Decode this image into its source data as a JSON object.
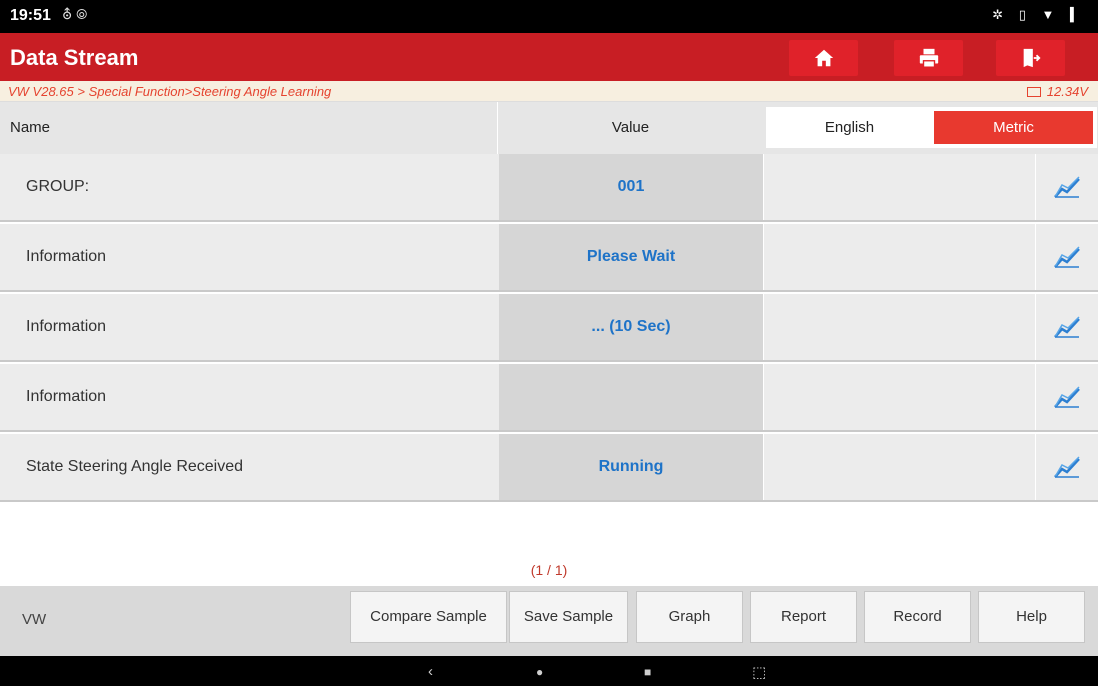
{
  "status": {
    "time": "19:51",
    "left_icons": "⛢ ⦾",
    "right_icons": "✲ ▯ ▼ ▍"
  },
  "header": {
    "title": "Data Stream",
    "buttons": [
      {
        "name": "home-button",
        "icon": "home-icon"
      },
      {
        "name": "print-button",
        "icon": "printer-icon"
      },
      {
        "name": "exit-button",
        "icon": "exit-icon"
      }
    ]
  },
  "breadcrumb": {
    "path": "VW V28.65 > Special Function>Steering Angle Learning",
    "voltage": "12.34V"
  },
  "table": {
    "col_name": "Name",
    "col_value": "Value",
    "unit_english": "English",
    "unit_metric": "Metric",
    "rows": [
      {
        "name": "GROUP:",
        "value": "001"
      },
      {
        "name": "Information",
        "value": "Please Wait"
      },
      {
        "name": "Information",
        "value": "... (10 Sec)"
      },
      {
        "name": "Information",
        "value": ""
      },
      {
        "name": "State Steering Angle Received",
        "value": "Running"
      }
    ]
  },
  "pager": "(1 / 1)",
  "footer": {
    "brand": "VW",
    "buttons": [
      "Compare Sample",
      "Save Sample",
      "Graph",
      "Report",
      "Record",
      "Help"
    ]
  },
  "nav": {
    "back": "‹",
    "home": "●",
    "recent": "■",
    "screenshot": "⬚"
  },
  "colors": {
    "titlebar": "#c81e24",
    "accent": "#e8392f",
    "value_text": "#1e73c8"
  }
}
